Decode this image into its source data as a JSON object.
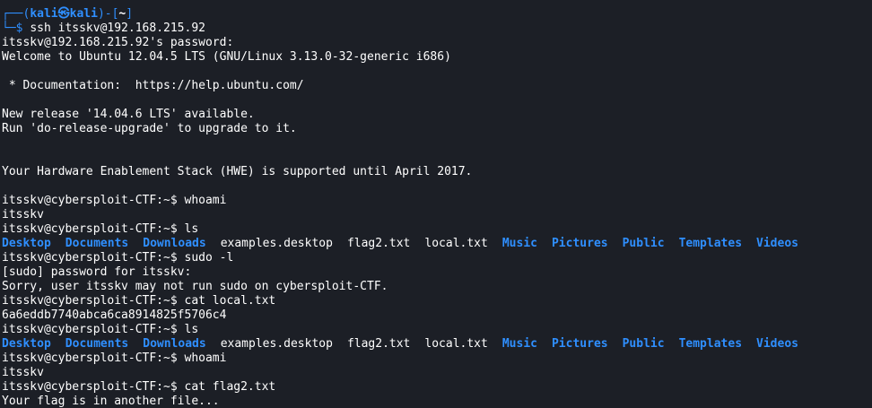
{
  "colors": {
    "background": "#1c1f26",
    "text": "#ffffff",
    "prompt_accent": "#2f8fff",
    "directory": "#2f8fff"
  },
  "prompt": {
    "box_top": "┌──(",
    "user_host": "kali㉿kali",
    "close_user": ")-[",
    "path": "~",
    "close_path": "]",
    "box_bottom": "└─$ ",
    "command": "ssh itsskv@192.168.215.92"
  },
  "output_1": [
    "itsskv@192.168.215.92's password:",
    "Welcome to Ubuntu 12.04.5 LTS (GNU/Linux 3.13.0-32-generic i686)",
    "",
    " * Documentation:  https://help.ubuntu.com/",
    "",
    "New release '14.04.6 LTS' available.",
    "Run 'do-release-upgrade' to upgrade to it.",
    "",
    "",
    "Your Hardware Enablement Stack (HWE) is supported until April 2017.",
    "",
    "itsskv@cybersploit-CTF:~$ whoami",
    "itsskv",
    "itsskv@cybersploit-CTF:~$ ls"
  ],
  "listing": [
    {
      "name": "Desktop",
      "is_dir": true
    },
    {
      "name": "Documents",
      "is_dir": true
    },
    {
      "name": "Downloads",
      "is_dir": true
    },
    {
      "name": "examples.desktop",
      "is_dir": false
    },
    {
      "name": "flag2.txt",
      "is_dir": false
    },
    {
      "name": "local.txt",
      "is_dir": false
    },
    {
      "name": "Music",
      "is_dir": true
    },
    {
      "name": "Pictures",
      "is_dir": true
    },
    {
      "name": "Public",
      "is_dir": true
    },
    {
      "name": "Templates",
      "is_dir": true
    },
    {
      "name": "Videos",
      "is_dir": true
    }
  ],
  "output_2": [
    "itsskv@cybersploit-CTF:~$ sudo -l",
    "[sudo] password for itsskv:",
    "Sorry, user itsskv may not run sudo on cybersploit-CTF.",
    "itsskv@cybersploit-CTF:~$ cat local.txt",
    "6a6eddb7740abca6ca8914825f5706c4",
    "itsskv@cybersploit-CTF:~$ ls"
  ],
  "output_3": [
    "itsskv@cybersploit-CTF:~$ whoami",
    "itsskv",
    "itsskv@cybersploit-CTF:~$ cat flag2.txt",
    "Your flag is in another file..."
  ]
}
